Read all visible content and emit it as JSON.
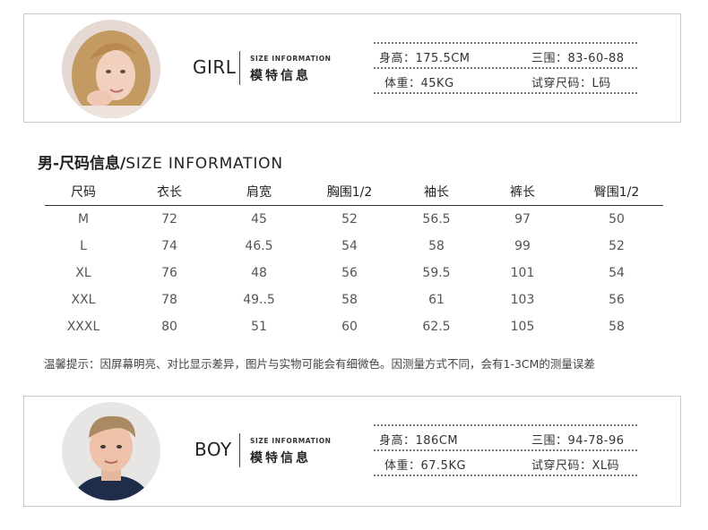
{
  "girl_card": {
    "gender": "GIRL",
    "size_info_en": "SIZE INFORMATION",
    "size_info_cn": "模特信息",
    "stats": {
      "height": "身高：175.5CM",
      "measurements": "三围：83-60-88",
      "weight": "体重：45KG",
      "trial_size": "试穿尺码：L码"
    }
  },
  "size_table": {
    "title_cn": "男-尺码信息/",
    "title_en": "SIZE INFORMATION",
    "headers": [
      "尺码",
      "衣长",
      "肩宽",
      "胸围1/2",
      "袖长",
      "裤长",
      "臀围1/2"
    ],
    "rows": [
      [
        "M",
        "72",
        "45",
        "52",
        "56.5",
        "97",
        "50"
      ],
      [
        "L",
        "74",
        "46.5",
        "54",
        "58",
        "99",
        "52"
      ],
      [
        "XL",
        "76",
        "48",
        "56",
        "59.5",
        "101",
        "54"
      ],
      [
        "XXL",
        "78",
        "49..5",
        "58",
        "61",
        "103",
        "56"
      ],
      [
        "XXXL",
        "80",
        "51",
        "60",
        "62.5",
        "105",
        "58"
      ]
    ],
    "note": "温馨提示：因屏幕明亮、对比显示差异，图片与实物可能会有细微色。因测量方式不同，会有1-3CM的测量误差"
  },
  "boy_card": {
    "gender": "BOY",
    "size_info_en": "SIZE INFORMATION",
    "size_info_cn": "模特信息",
    "stats": {
      "height": "身高：186CM",
      "measurements": "三围：94-78-96",
      "weight": "体重：67.5KG",
      "trial_size": "试穿尺码：XL码"
    }
  }
}
